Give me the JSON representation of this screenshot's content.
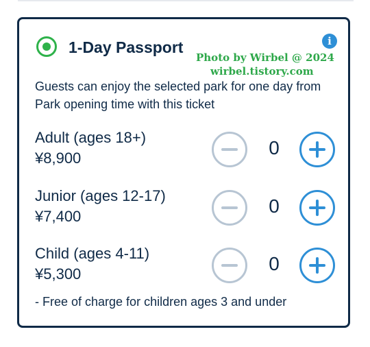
{
  "passport": {
    "title": "1-Day Passport",
    "selected": true,
    "description": "Guests can enjoy the selected park for one day from Park opening time with this ticket",
    "info_icon": "info-icon",
    "rows": [
      {
        "label": "Adult (ages 18+)",
        "price": "¥8,900",
        "quantity": "0"
      },
      {
        "label": "Junior (ages 12-17)",
        "price": "¥7,400",
        "quantity": "0"
      },
      {
        "label": "Child (ages 4-11)",
        "price": "¥5,300",
        "quantity": "0"
      }
    ],
    "note": "- Free of charge for children ages 3 and under"
  },
  "watermark": {
    "line1": "Photo by Wirbel @ 2024",
    "line2": "wirbel.tistory.com"
  },
  "colors": {
    "text": "#0f2a47",
    "border": "#0f2a47",
    "radio": "#2eb24a",
    "accent": "#2e8fd6",
    "disabled": "#b7c5d3",
    "watermark": "#2ea84a"
  }
}
